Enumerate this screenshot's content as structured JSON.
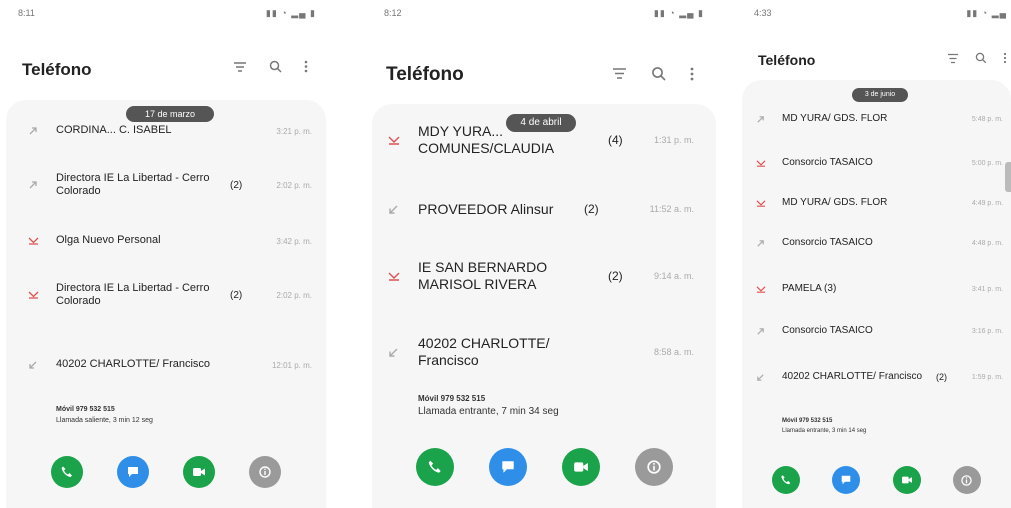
{
  "colors": {
    "green": "#1aa34a",
    "blue": "#2f8fe8",
    "grey": "#9a9a9a",
    "missed": "#e05050",
    "pill": "#555555"
  },
  "screens": [
    {
      "status_time": "8:11",
      "title": "Teléfono",
      "date_pill": "17 de marzo",
      "rows": [
        {
          "name": "CORDINA... C. ISABEL",
          "count": "",
          "time": "3:21 p. m.",
          "icon": "call-outgoing-icon",
          "missed": false
        },
        {
          "name": "Directora IE La Libertad - Cerro Colorado",
          "count": "(2)",
          "time": "2:02 p. m.",
          "icon": "call-outgoing-icon",
          "missed": false
        },
        {
          "name": "Olga Nuevo Personal",
          "count": "",
          "time": "3:42 p. m.",
          "icon": "call-missed-icon",
          "missed": true
        },
        {
          "name": "Directora IE La Libertad - Cerro Colorado",
          "count": "(2)",
          "time": "2:02 p. m.",
          "icon": "call-missed-icon",
          "missed": true
        },
        {
          "name": "40202 CHARLOTTE/ Francisco",
          "count": "",
          "time": "12:01 p. m.",
          "icon": "call-incoming-icon",
          "missed": false
        }
      ],
      "detail_line1": "Móvil 979 532 515",
      "detail_line2": "Llamada saliente, 3 min 12 seg"
    },
    {
      "status_time": "8:12",
      "title": "Teléfono",
      "date_pill": "4 de abril",
      "rows": [
        {
          "name": "MDY YURA... COMUNES/CLAUDIA",
          "count": "(4)",
          "time": "1:31 p. m.",
          "icon": "call-missed-icon",
          "missed": true
        },
        {
          "name": "PROVEEDOR Alinsur",
          "count": "(2)",
          "time": "11:52 a. m.",
          "icon": "call-incoming-icon",
          "missed": false
        },
        {
          "name": "IE SAN BERNARDO MARISOL RIVERA",
          "count": "(2)",
          "time": "9:14 a. m.",
          "icon": "call-missed-icon",
          "missed": true
        },
        {
          "name": "40202 CHARLOTTE/ Francisco",
          "count": "",
          "time": "8:58 a. m.",
          "icon": "call-incoming-icon",
          "missed": false
        }
      ],
      "detail_line1": "Móvil 979 532 515",
      "detail_line2": "Llamada entrante, 7 min 34 seg"
    },
    {
      "status_time": "4:33",
      "title": "Teléfono",
      "date_pill": "3 de junio",
      "rows": [
        {
          "name": "MD YURA/ GDS. FLOR",
          "count": "",
          "time": "5:48 p. m.",
          "icon": "call-outgoing-icon",
          "missed": false
        },
        {
          "name": "Consorcio TASAICO",
          "count": "",
          "time": "5:00 p. m.",
          "icon": "call-missed-icon",
          "missed": true
        },
        {
          "name": "MD YURA/ GDS. FLOR",
          "count": "",
          "time": "4:49 p. m.",
          "icon": "call-missed-icon",
          "missed": true
        },
        {
          "name": "Consorcio TASAICO",
          "count": "",
          "time": "4:48 p. m.",
          "icon": "call-outgoing-icon",
          "missed": false
        },
        {
          "name": "PAMELA (3)",
          "count": "",
          "time": "3:41 p. m.",
          "icon": "call-missed-icon",
          "missed": true
        },
        {
          "name": "Consorcio TASAICO",
          "count": "",
          "time": "3:16 p. m.",
          "icon": "call-outgoing-icon",
          "missed": false
        },
        {
          "name": "40202 CHARLOTTE/ Francisco",
          "count": "(2)",
          "time": "1:59 p. m.",
          "icon": "call-incoming-icon",
          "missed": false
        }
      ],
      "detail_line1": "Móvil 979 532 515",
      "detail_line2": "Llamada entrante, 3 min 14 seg"
    }
  ]
}
